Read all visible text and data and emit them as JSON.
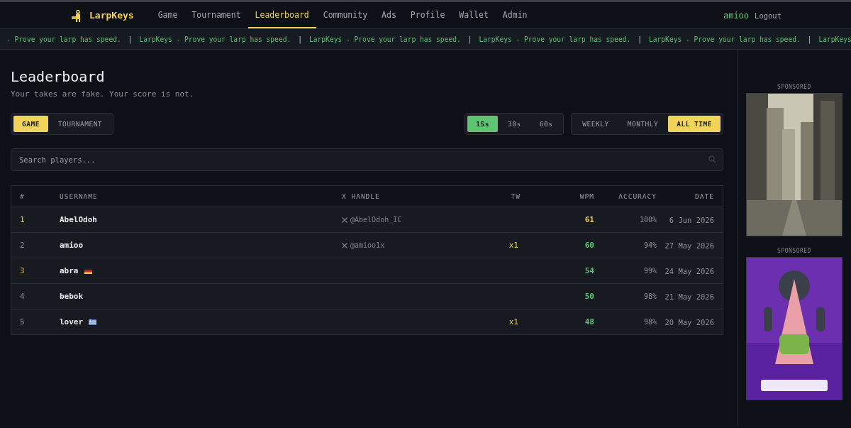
{
  "header": {
    "brand": "LarpKeys",
    "nav": [
      {
        "label": "Game",
        "selected": false
      },
      {
        "label": "Tournament",
        "selected": false
      },
      {
        "label": "Leaderboard",
        "selected": true
      },
      {
        "label": "Community",
        "selected": false
      },
      {
        "label": "Ads",
        "selected": false
      },
      {
        "label": "Profile",
        "selected": false
      },
      {
        "label": "Wallet",
        "selected": false
      },
      {
        "label": "Admin",
        "selected": false
      }
    ],
    "user": "amioo",
    "logout": "Logout"
  },
  "ticker": {
    "separator": "|",
    "items": [
      "- Prove your larp has speed.",
      "LarpKeys - Prove your larp has speed.",
      "LarpKeys - Prove your larp has speed.",
      "LarpKeys - Prove your larp has speed.",
      "LarpKeys - Prove your larp has speed.",
      "LarpKeys"
    ]
  },
  "page": {
    "title": "Leaderboard",
    "subtitle": "Your takes are fake. Your score is not."
  },
  "mode_tabs": [
    {
      "label": "GAME",
      "selected": true
    },
    {
      "label": "TOURNAMENT",
      "selected": false
    }
  ],
  "duration_tabs": [
    {
      "label": "15s",
      "selected": true
    },
    {
      "label": "30s",
      "selected": false
    },
    {
      "label": "60s",
      "selected": false
    }
  ],
  "period_tabs": [
    {
      "label": "WEEKLY",
      "selected": false
    },
    {
      "label": "MONTHLY",
      "selected": false
    },
    {
      "label": "ALL TIME",
      "selected": true
    }
  ],
  "search": {
    "placeholder": "Search players..."
  },
  "table": {
    "columns": [
      "#",
      "USERNAME",
      "X HANDLE",
      "TW",
      "WPM",
      "ACCURACY",
      "DATE"
    ],
    "rows": [
      {
        "rank": {
          "text": "1",
          "color": "#e6cf5b"
        },
        "username": "AbelOdoh",
        "x_handle": "@AbelOdoh_IC",
        "wpm": {
          "text": "61",
          "color": "#e6cf5b"
        },
        "accuracy": "100%",
        "date": "6 Jun 2026"
      },
      {
        "rank": {
          "text": "2",
          "color": "#8d9199"
        },
        "username": "amioo",
        "x_handle": "@amioo1x",
        "tw": "x1",
        "wpm": {
          "text": "60",
          "color": "#5fc472"
        },
        "accuracy": "94%",
        "date": "27 May 2026"
      },
      {
        "rank": {
          "text": "3",
          "color": "#e8a23a"
        },
        "username": "abra",
        "flag": {
          "kind": "de"
        },
        "wpm": {
          "text": "54",
          "color": "#5fc472"
        },
        "accuracy": "99%",
        "date": "24 May 2026"
      },
      {
        "rank": {
          "text": "4",
          "color": "#8d9199"
        },
        "username": "bebok",
        "wpm": {
          "text": "50",
          "color": "#5fc472"
        },
        "accuracy": "98%",
        "date": "21 May 2026"
      },
      {
        "rank": {
          "text": "5",
          "color": "#8d9199"
        },
        "username": "lover",
        "flag": {
          "kind": "gr"
        },
        "tw": "x1",
        "wpm": {
          "text": "48",
          "color": "#5fc472"
        },
        "accuracy": "98%",
        "date": "20 May 2026"
      }
    ]
  },
  "sidebar": {
    "ads": [
      {
        "label": "SPONSORED",
        "kind": "city"
      },
      {
        "label": "SPONSORED",
        "kind": "cartoon"
      }
    ]
  }
}
